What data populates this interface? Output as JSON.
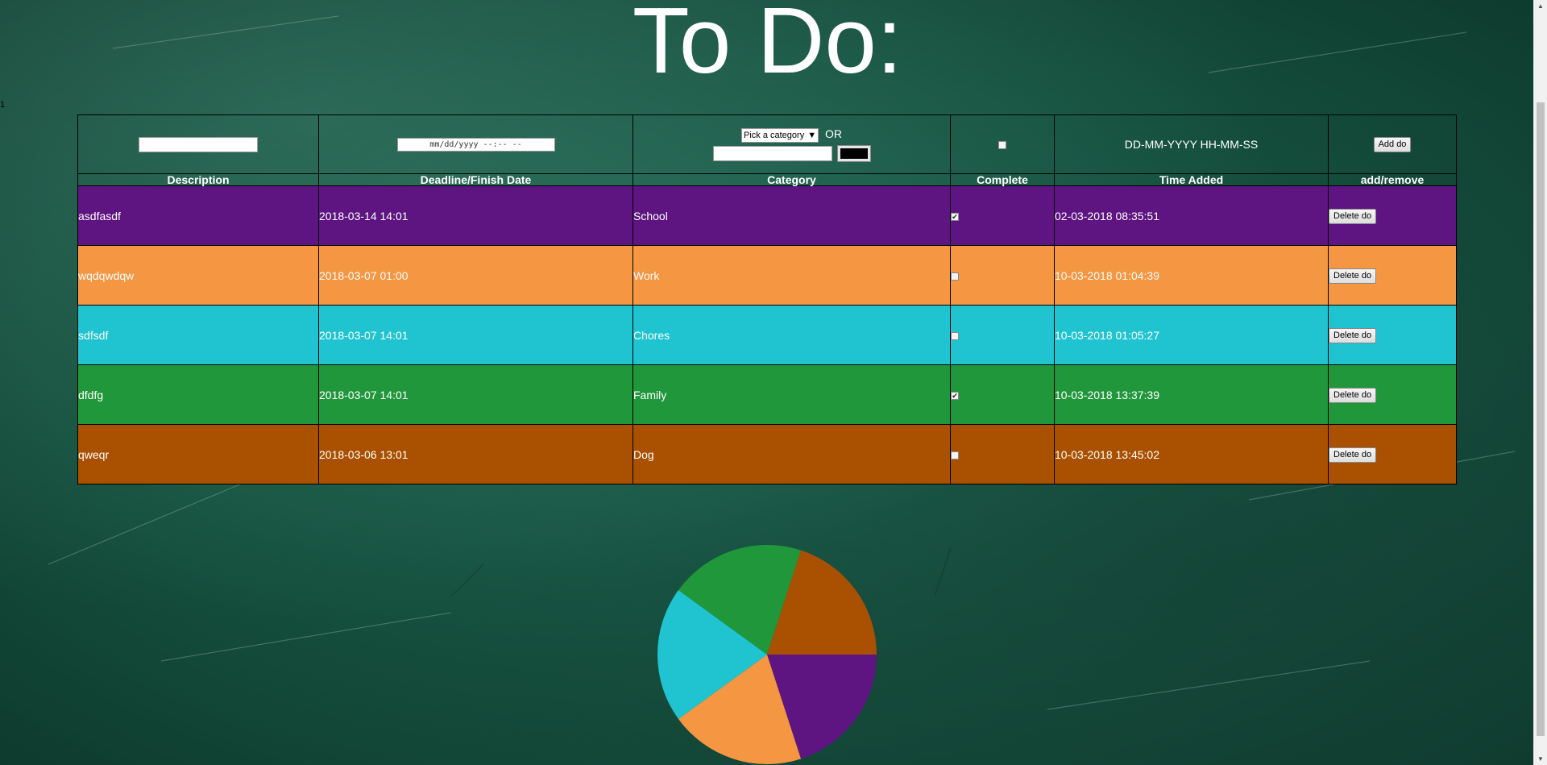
{
  "page": {
    "title": "To Do:",
    "stray_mark": "1"
  },
  "form": {
    "date_placeholder": "mm/dd/yyyy --:-- --",
    "category_select": "Pick a category",
    "category_or": "OR",
    "color_value": "#000000",
    "time_format": "DD-MM-YYYY HH-MM-SS",
    "add_label": "Add do"
  },
  "columns": [
    "Description",
    "Deadline/Finish Date",
    "Category",
    "Complete",
    "Time Added",
    "add/remove"
  ],
  "rows": [
    {
      "description": "asdfasdf",
      "deadline": "2018-03-14 14:01",
      "category": "School",
      "complete": true,
      "time_added": "02-03-2018 08:35:51",
      "action": "Delete do",
      "color": "#5e1481"
    },
    {
      "description": "wqdqwdqw",
      "deadline": "2018-03-07 01:00",
      "category": "Work",
      "complete": false,
      "time_added": "10-03-2018 01:04:39",
      "action": "Delete do",
      "color": "#f49642"
    },
    {
      "description": "sdfsdf",
      "deadline": "2018-03-07 14:01",
      "category": "Chores",
      "complete": false,
      "time_added": "10-03-2018 01:05:27",
      "action": "Delete do",
      "color": "#1fc4d0"
    },
    {
      "description": "dfdfg",
      "deadline": "2018-03-07 14:01",
      "category": "Family",
      "complete": true,
      "time_added": "10-03-2018 13:37:39",
      "action": "Delete do",
      "color": "#21973c"
    },
    {
      "description": "qweqr",
      "deadline": "2018-03-06 13:01",
      "category": "Dog",
      "complete": false,
      "time_added": "10-03-2018 13:45:02",
      "action": "Delete do",
      "color": "#a95100"
    }
  ],
  "chart_data": {
    "type": "pie",
    "labels": [],
    "values": [
      1,
      1,
      1,
      1,
      1
    ],
    "colors": [
      "#5e1481",
      "#f49642",
      "#1fc4d0",
      "#21973c",
      "#a95100"
    ],
    "title": ""
  }
}
